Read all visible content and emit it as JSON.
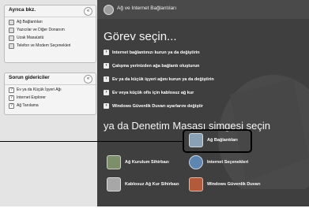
{
  "sidebar": {
    "panel1": {
      "title": "Ayrıca bkz.",
      "items": [
        {
          "label": "Ağ Bağlantıları"
        },
        {
          "label": "Yazıcılar ve Diğer Donanım"
        },
        {
          "label": "Uzak Masaüstü"
        },
        {
          "label": "Telefon ve Modem Seçenekleri"
        }
      ]
    },
    "panel2": {
      "title": "Sorun gidericiler",
      "items": [
        {
          "label": "Ev ya da Küçük İşyeri Ağı"
        },
        {
          "label": "Internet Explorer"
        },
        {
          "label": "Ağ Tanılama"
        }
      ]
    }
  },
  "main": {
    "title": "Ağ ve Internet Bağlantıları",
    "task_heading": "Görev seçin...",
    "tasks": [
      "Internet bağlantınızı kurun ya da değiştirin",
      "Çalışma yerinizden ağa bağlantı oluşturun",
      "Ev ya da küçük işyeri ağını kurun ya da değiştirin",
      "Ev veya küçük ofis için kablosuz ağ kur",
      "Windows Güvenlik Duvarı ayarlarını değiştir"
    ],
    "cp_heading": "ya da Denetim Masası simgesi seçin",
    "cp_items": {
      "highlighted": "Ağ Bağlantıları",
      "network_setup": "Ağ Kurulum Sihirbazı",
      "internet_options": "Internet Seçenekleri",
      "wireless_setup": "Kablosuz Ağ Kur Sihirbazı",
      "firewall": "Windows Güvenlik Duvarı"
    }
  }
}
